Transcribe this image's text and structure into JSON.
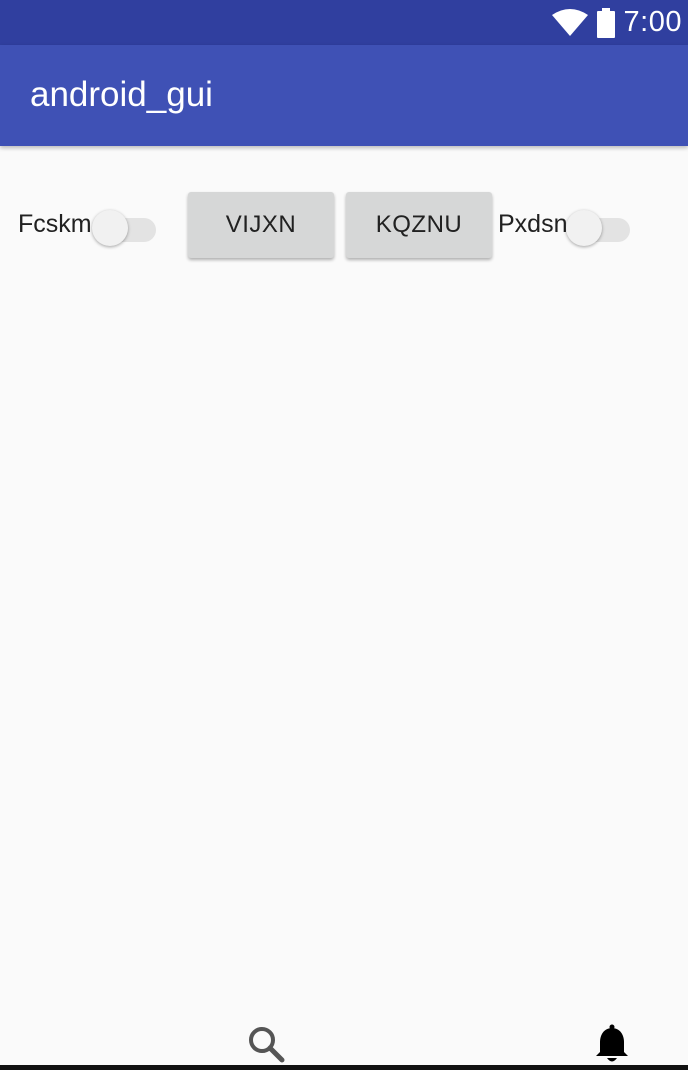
{
  "status_bar": {
    "time": "7:00",
    "icons": [
      "wifi-icon",
      "battery-icon"
    ],
    "color": "#303f9f"
  },
  "app_bar": {
    "title": "android_gui",
    "color": "#3f51b5"
  },
  "controls": {
    "switch_1": {
      "label": "Fcskm",
      "checked": false
    },
    "button_1": {
      "label": "VIJXN"
    },
    "button_2": {
      "label": "KQZNU"
    },
    "switch_2": {
      "label": "Pxdsn",
      "checked": false
    }
  },
  "bottom_bar": {
    "icons": [
      "search-icon",
      "bell-icon"
    ]
  }
}
